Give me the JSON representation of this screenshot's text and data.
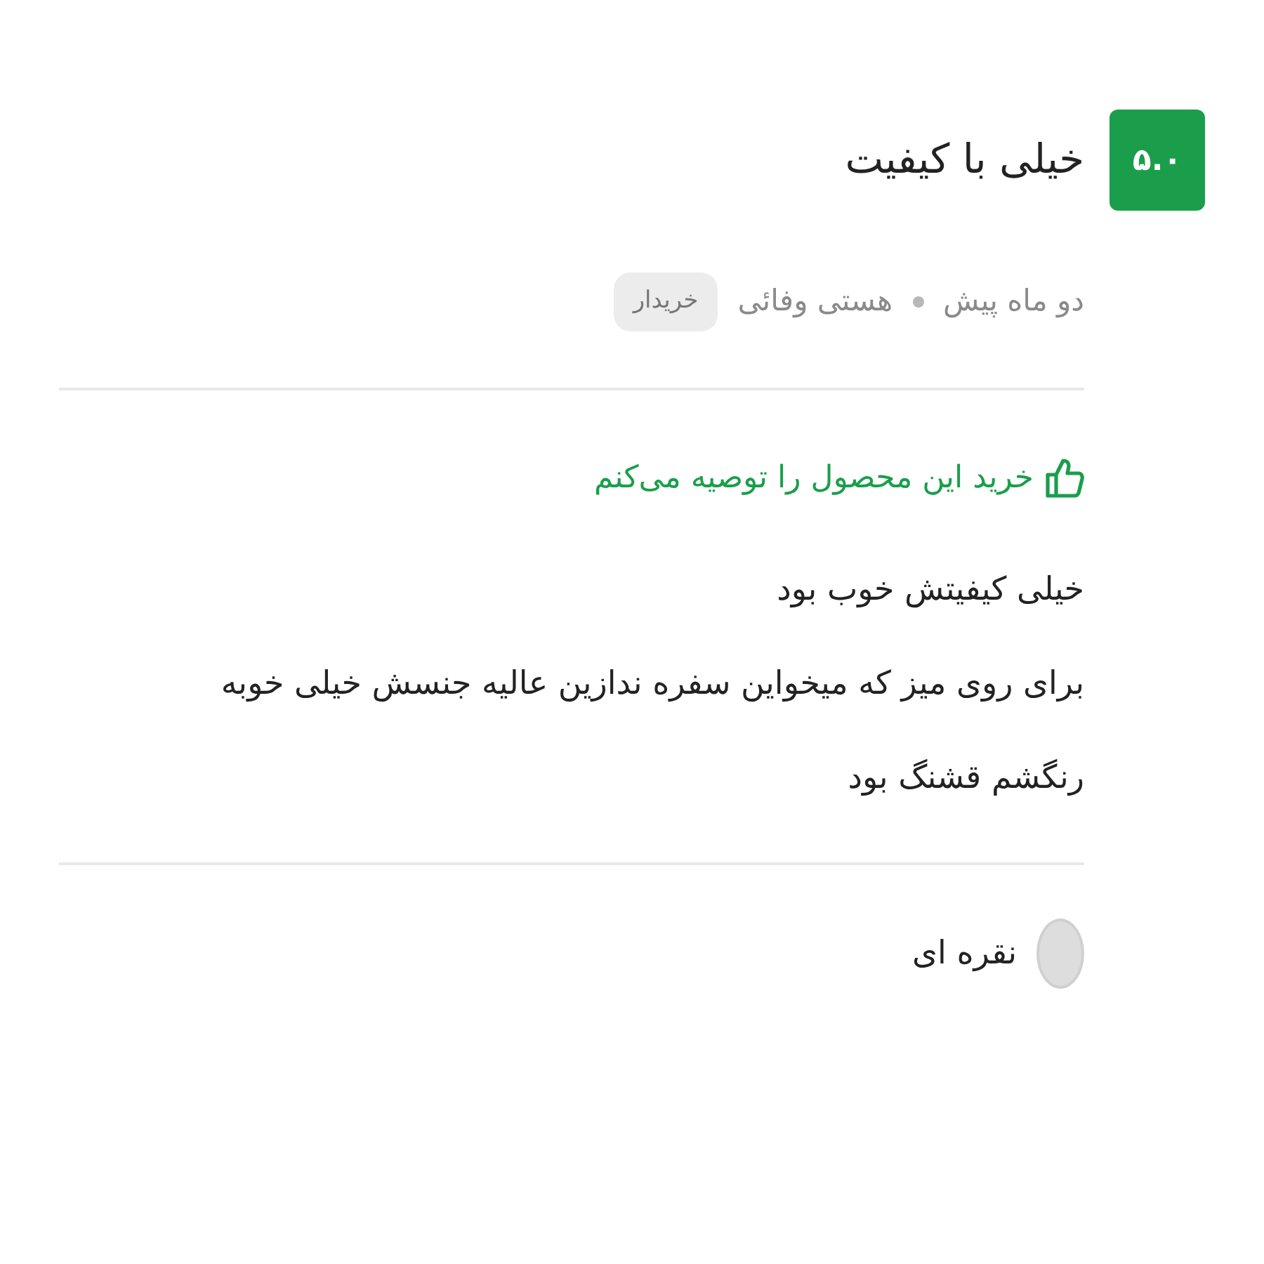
{
  "review": {
    "score": "۵.۰",
    "title": "خیلی با کیفیت",
    "meta": {
      "date": "دو ماه پیش",
      "author": "هستی وفائی",
      "badge": "خریدار"
    },
    "recommendation": {
      "recommended": true,
      "text": "خرید این محصول را توصیه می‌کنم"
    },
    "body": [
      "خیلی کیفیتش خوب بود",
      "برای روی میز که میخواین سفره ندازین عالیه جنسش خیلی خوبه",
      "رنگشم قشنگ بود"
    ],
    "variant": {
      "label": "نقره ای",
      "color": "#dddddd"
    }
  }
}
